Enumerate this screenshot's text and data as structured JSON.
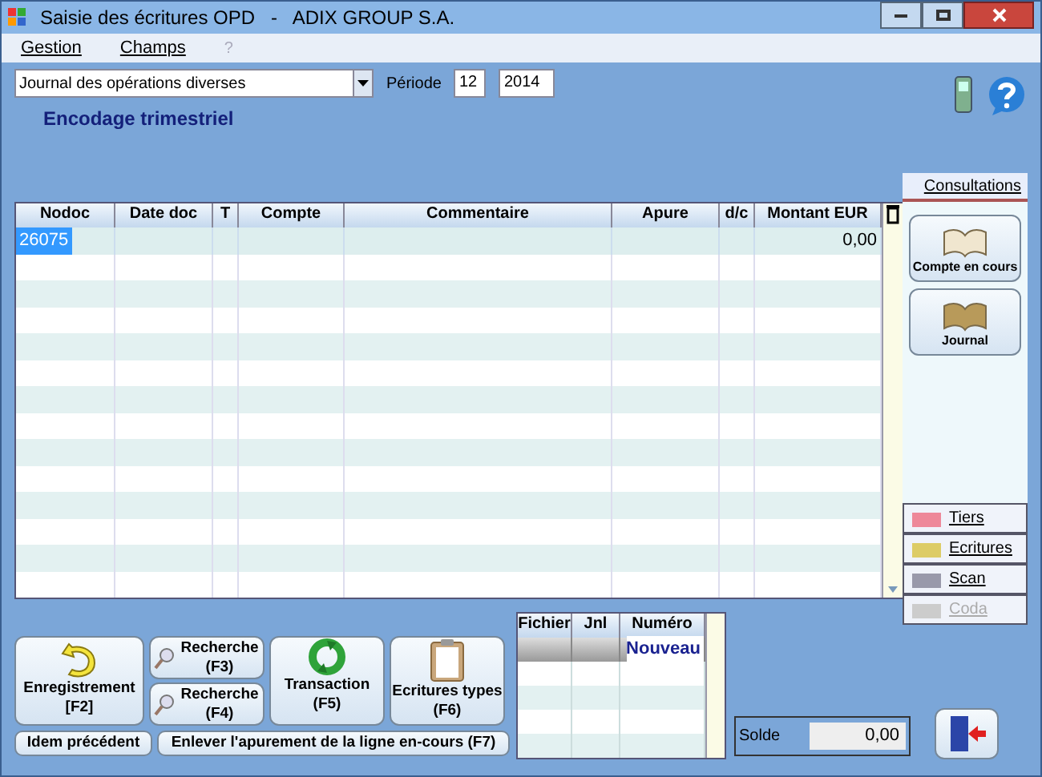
{
  "window": {
    "title": "Saisie des écritures OPD   -   ADIX GROUP S.A."
  },
  "menu": [
    {
      "label": "Gestion",
      "disabled": false
    },
    {
      "label": "Champs",
      "disabled": false
    },
    {
      "label": "?",
      "disabled": true
    }
  ],
  "journal": {
    "value": "Journal des opérations diverses"
  },
  "period": {
    "label": "Période",
    "month": "12",
    "year": "2014"
  },
  "subtitle": "Encodage trimestriel",
  "table": {
    "columns": [
      "Nodoc",
      "Date doc",
      "T",
      "Compte",
      "Commentaire",
      "Apure",
      "d/c",
      "Montant EUR"
    ],
    "rows": [
      {
        "cells": [
          "26075",
          "",
          "",
          "",
          "",
          "",
          "",
          "0,00"
        ],
        "selected": true
      }
    ]
  },
  "side_panel": {
    "header": {
      "label": "Consultations",
      "selected": true
    },
    "buttons": [
      {
        "label": "Compte en cours"
      },
      {
        "label": "Journal"
      }
    ],
    "tabs": [
      {
        "label": "Tiers",
        "disabled": false
      },
      {
        "label": "Ecritures",
        "disabled": false
      },
      {
        "label": "Scan",
        "disabled": false
      },
      {
        "label": "Coda",
        "disabled": true
      }
    ]
  },
  "actions": [
    {
      "label": "Enregistrement",
      "key": "[F2]",
      "kind": "big"
    },
    {
      "label": "Recherche",
      "key": "(F3)",
      "kind": "small"
    },
    {
      "label": "Recherche",
      "key": "(F4)",
      "kind": "small"
    },
    {
      "label": "Transaction",
      "key": "(F5)",
      "kind": "big"
    },
    {
      "label": "Ecritures types",
      "key": "(F6)",
      "kind": "big"
    }
  ],
  "bottom_buttons": [
    "Idem précédent",
    "Enlever l'apurement de la ligne en-cours (F7)"
  ],
  "files": {
    "columns": [
      "Fichier",
      "Jnl",
      "Numéro"
    ],
    "rows": [
      {
        "cells": [
          "",
          "",
          "Nouveau"
        ],
        "selected": true
      }
    ]
  },
  "balance": {
    "label": "Solde",
    "value": "0,00"
  }
}
